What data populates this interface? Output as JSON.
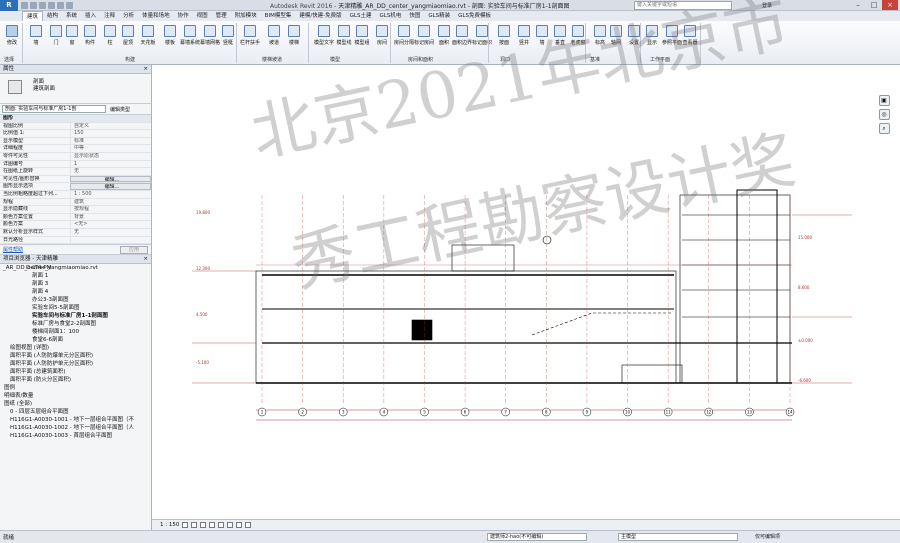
{
  "titlebar": {
    "app_button": "R",
    "app_name": "Autodesk Revit 2016 -",
    "doc_title": "天津精雕_AR_DD_center_yangmiaomiao.rvt - 剖面: 实验车间与标准厂房1-1剖面图",
    "search_placeholder": "键入关键字或短语",
    "login": "登录"
  },
  "ribbon_tabs": [
    "建筑",
    "结构",
    "系统",
    "插入",
    "注释",
    "分析",
    "体量和场地",
    "协作",
    "视图",
    "管理",
    "附加模块",
    "BIM模型集",
    "建模/快建-免费版",
    "GLS土建",
    "GLS机电",
    "快图",
    "GLS精装",
    "GLS免费模板"
  ],
  "ribbon_tools": [
    {
      "label": "修改",
      "icon": "modify-icon"
    },
    {
      "label": "墙",
      "icon": "wall-icon"
    },
    {
      "label": "门",
      "icon": "door-icon"
    },
    {
      "label": "窗",
      "icon": "window-icon"
    },
    {
      "label": "构件",
      "icon": "component-icon"
    },
    {
      "label": "柱",
      "icon": "column-icon"
    },
    {
      "label": "屋顶",
      "icon": "roof-icon"
    },
    {
      "label": "天花板",
      "icon": "ceiling-icon"
    },
    {
      "label": "楼板",
      "icon": "floor-icon"
    },
    {
      "label": "幕墙系统",
      "icon": "curtain-system-icon"
    },
    {
      "label": "幕墙网格",
      "icon": "curtain-grid-icon"
    },
    {
      "label": "竖梃",
      "icon": "mullion-icon"
    },
    {
      "label": "栏杆扶手",
      "icon": "railing-icon"
    },
    {
      "label": "坡道",
      "icon": "ramp-icon"
    },
    {
      "label": "楼梯",
      "icon": "stair-icon"
    },
    {
      "label": "模型文字",
      "icon": "model-text-icon"
    },
    {
      "label": "模型线",
      "icon": "model-line-icon"
    },
    {
      "label": "模型组",
      "icon": "model-group-icon"
    },
    {
      "label": "房间",
      "icon": "room-icon"
    },
    {
      "label": "房间分隔",
      "icon": "room-separator-icon"
    },
    {
      "label": "标记房间",
      "icon": "tag-room-icon"
    },
    {
      "label": "面积",
      "icon": "area-icon"
    },
    {
      "label": "面积边界",
      "icon": "area-boundary-icon"
    },
    {
      "label": "标记面积",
      "icon": "tag-area-icon"
    },
    {
      "label": "按面",
      "icon": "by-face-icon"
    },
    {
      "label": "竖井",
      "icon": "shaft-icon"
    },
    {
      "label": "墙",
      "icon": "wall-opening-icon"
    },
    {
      "label": "垂直",
      "icon": "vertical-icon"
    },
    {
      "label": "老虎窗",
      "icon": "dormer-icon"
    },
    {
      "label": "标高",
      "icon": "level-icon"
    },
    {
      "label": "轴网",
      "icon": "grid-icon"
    },
    {
      "label": "设置",
      "icon": "set-icon"
    },
    {
      "label": "显示",
      "icon": "show-icon"
    },
    {
      "label": "参照平面",
      "icon": "ref-plane-icon"
    },
    {
      "label": "查看器",
      "icon": "viewer-icon"
    }
  ],
  "ribbon_groups": [
    "选择",
    "构建",
    "楼梯坡道",
    "模型",
    "房间和面积",
    "洞口",
    "基准",
    "工作平面"
  ],
  "properties": {
    "header": "属性",
    "type_name_line1": "剖面",
    "type_name_line2": "建筑剖面",
    "view_selector": "剖面: 实验车间与标准厂房1-1剖",
    "edit_type": "编辑类型",
    "rows": [
      {
        "k": "图形",
        "v": "",
        "cat": true
      },
      {
        "k": "视图比例",
        "v": "自定义"
      },
      {
        "k": "比例值 1:",
        "v": "150"
      },
      {
        "k": "显示模型",
        "v": "标准"
      },
      {
        "k": "详细程度",
        "v": "中等"
      },
      {
        "k": "零件可见性",
        "v": "显示原状态"
      },
      {
        "k": "详图编号",
        "v": "1"
      },
      {
        "k": "在图纸上旋转",
        "v": "无"
      },
      {
        "k": "可见性/图形替换",
        "v": "编辑...",
        "btn": true
      },
      {
        "k": "图形显示选项",
        "v": "编辑...",
        "btn": true
      },
      {
        "k": "当比例粗略度超过下列...",
        "v": "1 : 500"
      },
      {
        "k": "规程",
        "v": "建筑"
      },
      {
        "k": "显示隐藏线",
        "v": "按规程"
      },
      {
        "k": "颜色方案位置",
        "v": "背景"
      },
      {
        "k": "颜色方案",
        "v": "<无>"
      },
      {
        "k": "默认分析显示样式",
        "v": "无"
      },
      {
        "k": "日光路径",
        "v": ""
      }
    ],
    "help_link": "属性帮助",
    "apply": "应用"
  },
  "browser": {
    "header": "项目浏览器 - 天津精雕_AR_DD_center_yangmiaomiao.rvt",
    "items": [
      "D-LT4-PM",
      "剖面 1",
      "剖面 3",
      "剖面 4",
      "办公3-3剖面图",
      "实验车间5-5剖面图",
      "实验车间与标准厂房1-1剖面图",
      "标准厂房与食堂2-2剖面图",
      "楼梯间剖面1：100",
      "食堂6-6剖面",
      "绘图视图 (详图)",
      "面积平面 (人防防爆单元分区面积)",
      "面积平面 (人防防护单元分区面积)",
      "面积平面 (总建筑面积)",
      "面积平面 (防火分区面积)",
      "图例",
      "明细表/数量",
      "图纸 (全部)",
      "0 - 四层五层组合平面图",
      "H116G1-A0030-1001 - 地下一层组合平面图（不",
      "H116G1-A0030-1002 - 地下一层组合平面图（人",
      "H116G1-A0030-1003 - 首层组合平面图"
    ]
  },
  "viewbar": {
    "scale": "1 : 150"
  },
  "status": {
    "left": "就绪",
    "workset": "建筑师2-hao(不可编辑)",
    "model": "主模型",
    "editable_only": "仅可编辑项"
  },
  "drawing": {
    "grid_labels": [
      "1",
      "2",
      "3",
      "4",
      "5",
      "6",
      "7",
      "8",
      "9",
      "10",
      "11",
      "12",
      "13",
      "14"
    ],
    "level_marks": [
      "19.800",
      "15.000",
      "12.300",
      "8.600",
      "4.500",
      "±0.000",
      "-5.100",
      "-6.600"
    ]
  },
  "watermark": {
    "line1": "北京2021年北京市",
    "line2": "秀工程勘察设计奖"
  }
}
